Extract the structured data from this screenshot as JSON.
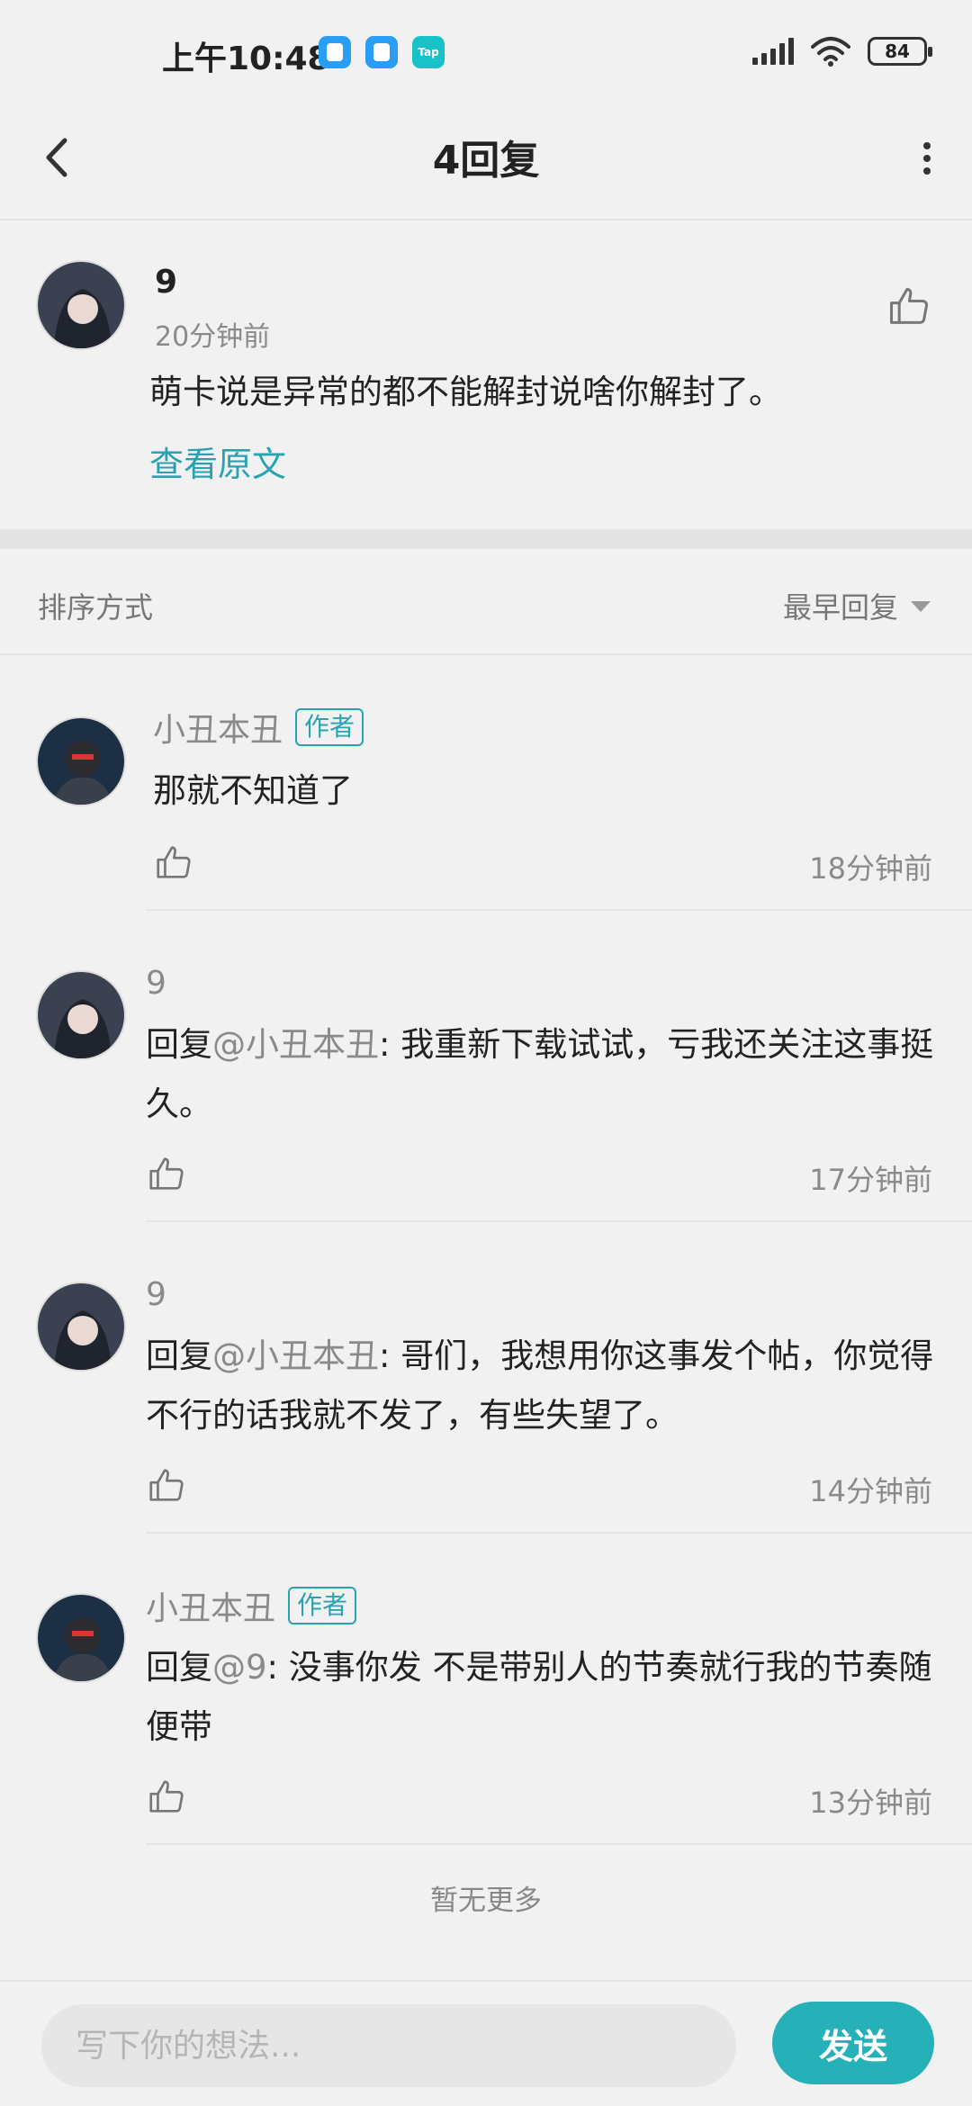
{
  "status_bar": {
    "time": "上午10:48",
    "tap_badge": "Tap",
    "battery": "84"
  },
  "header": {
    "title": "4回复"
  },
  "original": {
    "user": "9",
    "time": "20分钟前",
    "text": "萌卡说是异常的都不能解封说啥你解封了。",
    "view_original": "查看原文"
  },
  "sort": {
    "label": "排序方式",
    "selected": "最早回复"
  },
  "replies": [
    {
      "user": "小丑本丑",
      "badge": "作者",
      "text": "那就不知道了",
      "time": "18分钟前"
    },
    {
      "user": "9",
      "reply_prefix": "回复",
      "mention": "@小丑本丑",
      "text": ": 我重新下载试试，亏我还关注这事挺久。",
      "time": "17分钟前"
    },
    {
      "user": "9",
      "reply_prefix": "回复",
      "mention": "@小丑本丑",
      "text": ": 哥们，我想用你这事发个帖，你觉得不行的话我就不发了，有些失望了。",
      "time": "14分钟前"
    },
    {
      "user": "小丑本丑",
      "badge": "作者",
      "reply_prefix": "回复",
      "mention": "@9",
      "text": ": 没事你发 不是带别人的节奏就行我的节奏随便带",
      "time": "13分钟前"
    }
  ],
  "footer_note": "暂无更多",
  "input": {
    "placeholder": "写下你的想法...",
    "send_label": "发送"
  },
  "colors": {
    "accent": "#2aa3b0",
    "send_button": "#26b0b8",
    "background": "#f1f1f1"
  },
  "icons": [
    "back-arrow-icon",
    "more-vertical-icon",
    "thumbs-up-icon",
    "caret-down-icon",
    "signal-icon",
    "wifi-icon",
    "battery-icon"
  ]
}
